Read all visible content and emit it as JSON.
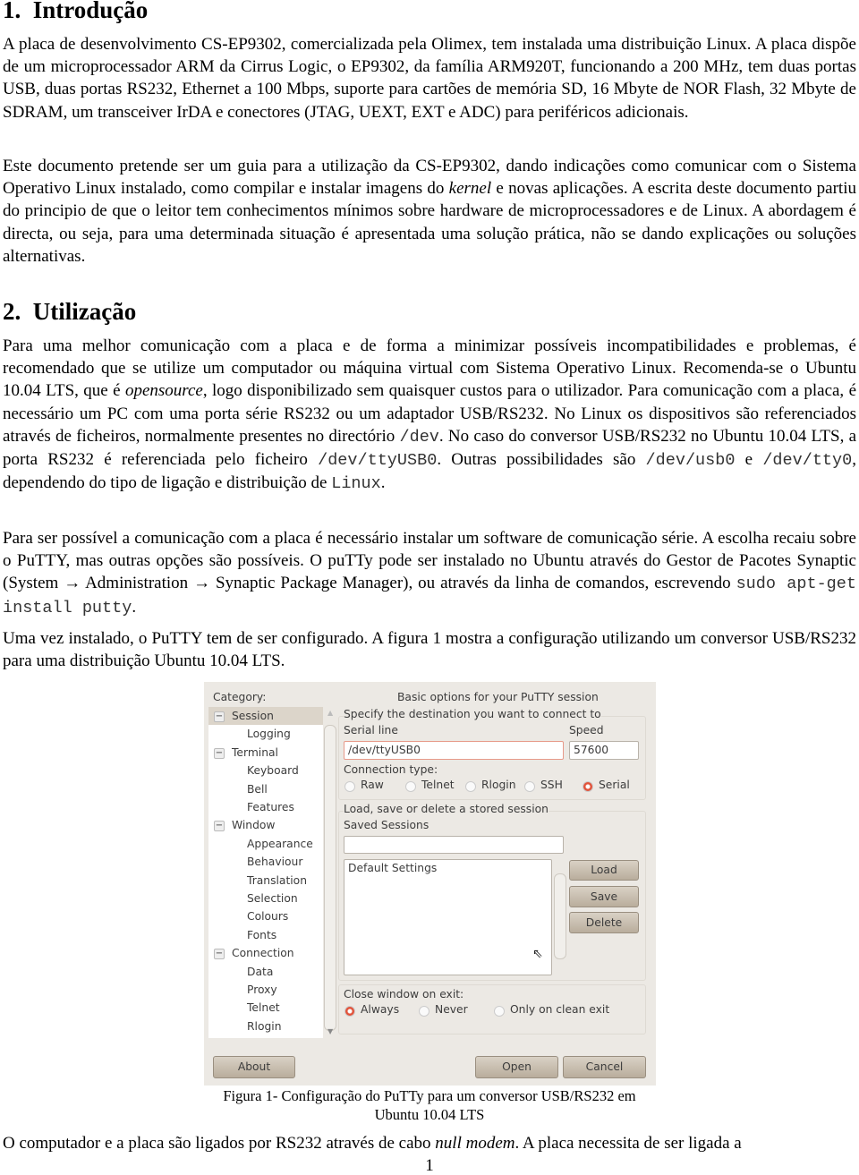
{
  "sections": [
    {
      "number": "1.",
      "title": "Introdução"
    },
    {
      "number": "2.",
      "title": "Utilização"
    }
  ],
  "paragraphs": [
    {
      "segments": [
        {
          "t": "A placa de desenvolvimento CS-EP9302, comercializada pela Olimex, tem instalada uma distribuição Linux. A placa dispõe de um microprocessador ARM da Cirrus Logic, o EP9302, da família ARM920T, funcionando a 200 MHz, tem duas portas USB, duas portas RS232, Ethernet a 100 Mbps, suporte para cartões de memória SD, 16 Mbyte de NOR Flash, 32 Mbyte de SDRAM, um transceiver IrDA e conectores (JTAG, UEXT, EXT e ADC) para periféricos adicionais."
        }
      ]
    },
    {
      "segments": [
        {
          "t": "Este documento pretende ser um guia para a utilização da CS-EP9302, dando indicações como comunicar com o Sistema Operativo Linux instalado, como compilar e instalar imagens do "
        },
        {
          "t": "kernel",
          "s": "it"
        },
        {
          "t": " e novas aplicações. A escrita deste documento partiu do principio de que o leitor tem conhecimentos mínimos sobre hardware de microprocessadores e de Linux. A abordagem é directa, ou seja, para uma determinada situação é apresentada uma solução prática, não se dando explicações ou soluções alternativas."
        }
      ]
    },
    {
      "segments": [
        {
          "t": "Para uma melhor comunicação com a placa e de forma a minimizar possíveis incompatibilidades e problemas, é recomendado que se utilize um computador ou máquina virtual com Sistema Operativo Linux. Recomenda-se o Ubuntu 10.04 LTS, que é "
        },
        {
          "t": "opensource",
          "s": "it"
        },
        {
          "t": ", logo disponibilizado sem quaisquer custos para o utilizador. Para comunicação com a placa, é necessário um PC com uma porta série RS232 ou um adaptador USB/RS232. No Linux os dispositivos são referenciados através de ficheiros, normalmente presentes no directório "
        },
        {
          "t": "/dev",
          "s": "mono"
        },
        {
          "t": ". No caso do conversor USB/RS232 no Ubuntu 10.04 LTS, a porta RS232 é referenciada pelo ficheiro "
        },
        {
          "t": "/dev/ttyUSB0",
          "s": "mono"
        },
        {
          "t": ". Outras possibilidades são "
        },
        {
          "t": "/dev/usb0",
          "s": "mono"
        },
        {
          "t": " e "
        },
        {
          "t": "/dev/tty0",
          "s": "mono"
        },
        {
          "t": ", dependendo do tipo de ligação e distribuição de "
        },
        {
          "t": "Linux",
          "s": "mono"
        },
        {
          "t": "."
        }
      ]
    },
    {
      "segments": [
        {
          "t": "Para ser possível a comunicação com a placa é necessário instalar um software de comunicação série. A escolha recaiu sobre o PuTTY, mas outras opções são possíveis. O puTTy pode ser instalado no Ubuntu através do Gestor de Pacotes Synaptic (System → Administration → Synaptic Package Manager), ou através da linha de comandos, escrevendo "
        },
        {
          "t": "sudo apt-get install putty",
          "s": "mono"
        },
        {
          "t": "."
        }
      ]
    },
    {
      "segments": [
        {
          "t": "Uma vez instalado, o PuTTY tem de ser configurado. A figura 1 mostra a configuração utilizando um conversor USB/RS232 para uma distribuição Ubuntu 10.04 LTS."
        }
      ]
    },
    {
      "segments": [
        {
          "t": "O computador e a placa são ligados por RS232 através de cabo "
        },
        {
          "t": "null modem",
          "s": "it"
        },
        {
          "t": ". A placa necessita de ser ligada a"
        }
      ]
    }
  ],
  "putty": {
    "category_label": "Category:",
    "tree": [
      {
        "label": "Session",
        "level": 0,
        "selected": true
      },
      {
        "label": "Logging",
        "level": 1
      },
      {
        "label": "Terminal",
        "level": 0
      },
      {
        "label": "Keyboard",
        "level": 1
      },
      {
        "label": "Bell",
        "level": 1
      },
      {
        "label": "Features",
        "level": 1
      },
      {
        "label": "Window",
        "level": 0
      },
      {
        "label": "Appearance",
        "level": 1
      },
      {
        "label": "Behaviour",
        "level": 1
      },
      {
        "label": "Translation",
        "level": 1
      },
      {
        "label": "Selection",
        "level": 1
      },
      {
        "label": "Colours",
        "level": 1
      },
      {
        "label": "Fonts",
        "level": 1
      },
      {
        "label": "Connection",
        "level": 0
      },
      {
        "label": "Data",
        "level": 1
      },
      {
        "label": "Proxy",
        "level": 1
      },
      {
        "label": "Telnet",
        "level": 1
      },
      {
        "label": "Rlogin",
        "level": 1
      }
    ],
    "title": "Basic options for your PuTTY session",
    "dest_label": "Specify the destination you want to connect to",
    "serial_line_label": "Serial line",
    "serial_line_value": "/dev/ttyUSB0",
    "speed_label": "Speed",
    "speed_value": "57600",
    "conn_type_label": "Connection type:",
    "conn_types": [
      {
        "label": "Raw"
      },
      {
        "label": "Telnet"
      },
      {
        "label": "Rlogin"
      },
      {
        "label": "SSH"
      },
      {
        "label": "Serial",
        "checked": true
      }
    ],
    "session_group_label": "Load, save or delete a stored session",
    "saved_sessions_label": "Saved Sessions",
    "saved_sessions_value": "",
    "sessions": [
      "Default Settings"
    ],
    "load": "Load",
    "save": "Save",
    "delete": "Delete",
    "close_label": "Close window on exit:",
    "close_options": [
      {
        "label": "Always",
        "checked": true
      },
      {
        "label": "Never"
      },
      {
        "label": "Only on clean exit"
      }
    ],
    "about": "About",
    "open": "Open",
    "cancel": "Cancel",
    "accent": "#e2533a"
  },
  "caption": [
    "Figura 1- Configuração do PuTTy para um conversor USB/RS232 em",
    "Ubuntu 10.04 LTS"
  ],
  "page_number": "1"
}
